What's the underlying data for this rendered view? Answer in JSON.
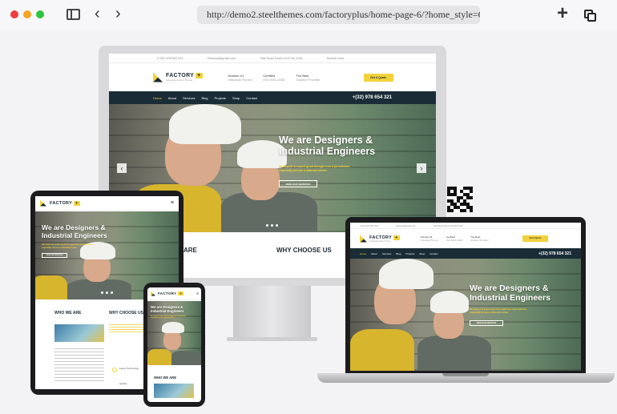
{
  "browser": {
    "url": "http://demo2.steelthemes.com/factoryplus/home-page-6/?home_style=6",
    "icons": [
      "sidebar-icon",
      "back-icon",
      "forward-icon",
      "new-tab-icon",
      "copy-icon"
    ],
    "back_glyph": "‹",
    "forward_glyph": "›",
    "plus_glyph": "+"
  },
  "site": {
    "brand": "FACTORY",
    "brand_plus": "+",
    "tagline": "Industrial Factory Theme",
    "topbar": {
      "phone": "(+32) 978 654 321",
      "email": "Factory@gmail.com",
      "address": "Flat Road Street (CA 94) USA",
      "search_placeholder": "Search here"
    },
    "info": [
      {
        "title": "Number #1",
        "sub": "Industrial Theme"
      },
      {
        "title": "Certified",
        "sub": "ISO 9001:2008"
      },
      {
        "title": "The Best",
        "sub": "Solution Provider"
      }
    ],
    "quote_button": "Get A Quote",
    "menu": [
      "Home",
      "About",
      "Services",
      "Blog",
      "Projects",
      "Shop",
      "Contact"
    ],
    "menu_active": "Home",
    "phone_display": "+(32) 978 654 321",
    "hero": {
      "line1": "We are Designers &",
      "line2": "Industrial Engineers",
      "sub1": "We Import & export good brought into a jurisdiction,",
      "sub2": "especially across a national border.",
      "button": "VIEW OUR SERVICES"
    },
    "sections": {
      "who_we_are": "WHO WE ARE",
      "why_choose_us": "WHY CHOOSE US",
      "are_partial": "ARE"
    },
    "tablet_extra": {
      "item1": "Latest Technology",
      "item2": "Quality"
    }
  },
  "colors": {
    "accent": "#f2d23a",
    "navy": "#1a2c36",
    "background": "#f3f3f5"
  }
}
